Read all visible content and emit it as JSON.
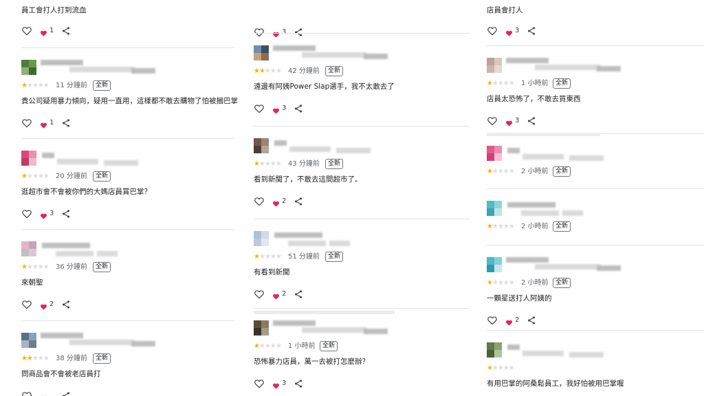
{
  "badge_label": "全新",
  "colors": {
    "star_on": "#f4b400",
    "star_off": "#dadce0",
    "heart": "#e0245e"
  },
  "icons": {
    "like": "heart-outline-icon",
    "liked": "heart-filled-icon",
    "share": "share-icon"
  },
  "columns": [
    {
      "reviews": [
        {
          "partial": true,
          "text": "員工會打人打到流血",
          "likes": "1"
        },
        {
          "avatar": [
            "#4e7d3a",
            "#6a9a4b",
            "#8fb36f",
            "#3d6b2c"
          ],
          "rating": 1,
          "time": "11 分鐘前",
          "text": "貴公司疑用暴力傾向，疑用一直用，這樣都不敢去購物了怕被摑巴掌",
          "likes": "1"
        },
        {
          "avatar": [
            "#d94a7b",
            "#e98fb0",
            "#c23a68",
            "#f2b9cc"
          ],
          "rating": 1,
          "time": "20 分鐘前",
          "text": "逛超市會不會被你們的大媽店員賞巴掌？",
          "likes": "3"
        },
        {
          "avatar": [
            "#e8b4c6",
            "#c9a4b8",
            "#bfbfbf",
            "#dcc7d0"
          ],
          "rating": 1,
          "time": "36 分鐘前",
          "text": "來朝聖",
          "likes": "2"
        },
        {
          "avatar": [
            "#5b6f86",
            "#8aa0b8",
            "#a7b4c2",
            "#6e7d8c"
          ],
          "rating": 2,
          "time": "38 分鐘前",
          "text": "問商品會不會被老店員打",
          "likes": "",
          "cut": true
        }
      ]
    },
    {
      "reviews": [
        {
          "partial": true,
          "text": "",
          "likes": "3"
        },
        {
          "avatar": [
            "#6d8fb3",
            "#3a4f66",
            "#c9a27a",
            "#8c6d52"
          ],
          "rating": 2,
          "time": "42 分鐘前",
          "text": "遠邊有阿姨Power Slap選手，我不太敢去了",
          "likes": "3"
        },
        {
          "avatar": [
            "#6a5a52",
            "#9a8576",
            "#4a3d36",
            "#b8a393"
          ],
          "rating": 1,
          "time": "43 分鐘前",
          "text": "看到新聞了，不敢去這間超市了。",
          "likes": "2"
        },
        {
          "avatar": [
            "#a9c3dc",
            "#d0dbe6",
            "#bfcad6",
            "#e1e7ee"
          ],
          "rating": 1,
          "time": "51 分鐘前",
          "text": "有看到新聞",
          "likes": "2"
        },
        {
          "avatar": [
            "#5a4a3c",
            "#8b7a5f",
            "#3a3128",
            "#a69a84"
          ],
          "rating": 1,
          "time": "1 小時前",
          "text": "恐怖暴力店員，萬一去被打怎麼辦？",
          "likes": "3"
        }
      ]
    },
    {
      "reviews": [
        {
          "partial": true,
          "text": "店員會打人",
          "likes": "3"
        },
        {
          "avatar": [
            "#b9a39a",
            "#d8c7bf",
            "#cdb5ab",
            "#e6d9d3"
          ],
          "rating": 1,
          "time": "1 小時前",
          "text": "店員太恐怖了，不敢去買東西",
          "likes": "3"
        },
        {
          "avatar": [
            "#e05a8d",
            "#f08bb3",
            "#d13f78",
            "#f7c0d5"
          ],
          "rating": 1,
          "time": "2 小時前",
          "text": "",
          "likes": ""
        },
        {
          "avatar": [
            "#58b8c4",
            "#8fd3da",
            "#3fa3b0",
            "#bde6ea"
          ],
          "rating": 1,
          "time": "2 小時前",
          "text": "",
          "likes": ""
        },
        {
          "avatar": [
            "#52b6c6",
            "#86cfd9",
            "#2f9aab",
            "#c3e9ee"
          ],
          "rating": 1,
          "time": "2 小時前",
          "text": "一顆星送打人阿姨的",
          "likes": "2"
        },
        {
          "avatar": [
            "#5f7a4a",
            "#8ea06e",
            "#4a6138",
            "#b3c29a"
          ],
          "rating": 1,
          "time": "",
          "text": "有用巴掌的阿桑鬆員工，我好怕被用巴掌喔",
          "likes": ""
        }
      ]
    }
  ]
}
